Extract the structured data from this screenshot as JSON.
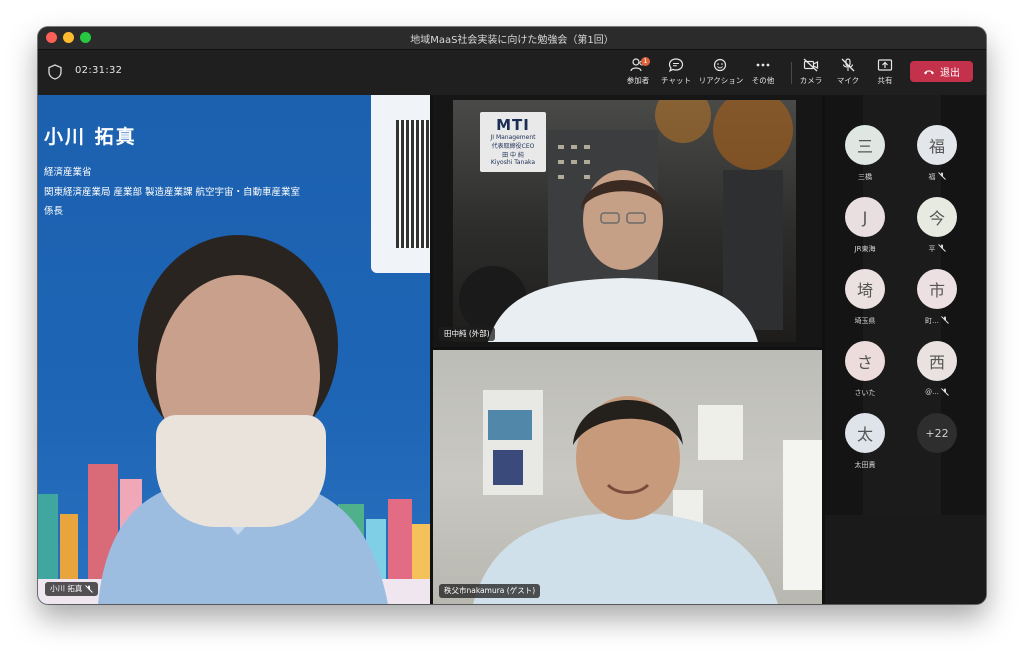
{
  "window": {
    "title": "地域MaaS社会実装に向けた勉強会（第1回）"
  },
  "toolbar": {
    "timer": "02:31:32",
    "items": [
      {
        "label": "参加者",
        "icon": "people-icon",
        "badge": "1"
      },
      {
        "label": "チャット",
        "icon": "chat-icon"
      },
      {
        "label": "リアクション",
        "icon": "reaction-icon"
      },
      {
        "label": "その他",
        "icon": "more-icon"
      },
      {
        "label": "カメラ",
        "icon": "camera-off-icon"
      },
      {
        "label": "マイク",
        "icon": "mic-off-icon"
      },
      {
        "label": "共有",
        "icon": "share-icon"
      }
    ],
    "leave_label": "退出",
    "leave_color": "#c4314b"
  },
  "tiles": {
    "main": {
      "bg_name": "小川 拓真",
      "bg_lines": [
        "経済産業省",
        "関東経済産業局 産業部 製造産業課 航空宇宙・自動車産業室",
        "係長"
      ],
      "name_tag": "小川 拓真",
      "muted": true
    },
    "top_right": {
      "name_tag": "田中純 (外部)",
      "logo_text": "MTI",
      "logo_lines": [
        "JI Management",
        "代表取締役CEO",
        "田 中 純",
        "Kiyoshi Tanaka"
      ]
    },
    "bottom_right": {
      "name_tag": "秩父市nakamura (ゲスト)"
    }
  },
  "participants": [
    {
      "initial": "三",
      "label": "三橋",
      "muted": false,
      "color": "#dfe7e2"
    },
    {
      "initial": "福",
      "label": "福",
      "muted": true,
      "color": "#e3e6ea"
    },
    {
      "initial": "J",
      "label": "JR東海",
      "muted": false,
      "color": "#eadfe0"
    },
    {
      "initial": "今",
      "label": "平",
      "muted": true,
      "color": "#e7eae0"
    },
    {
      "initial": "埼",
      "label": "埼玉県",
      "muted": false,
      "color": "#ece1e1"
    },
    {
      "initial": "市",
      "label": "町...",
      "muted": true,
      "color": "#ece0e2"
    },
    {
      "initial": "さ",
      "label": "さいた",
      "muted": false,
      "color": "#ecdcdc"
    },
    {
      "initial": "西",
      "label": "@...",
      "muted": true,
      "color": "#e9e2e0"
    },
    {
      "initial": "太",
      "label": "太田責",
      "muted": false,
      "color": "#dfe3ea"
    },
    {
      "initial": "+22",
      "label": "",
      "muted": false,
      "color": "#2e2e2e"
    }
  ]
}
